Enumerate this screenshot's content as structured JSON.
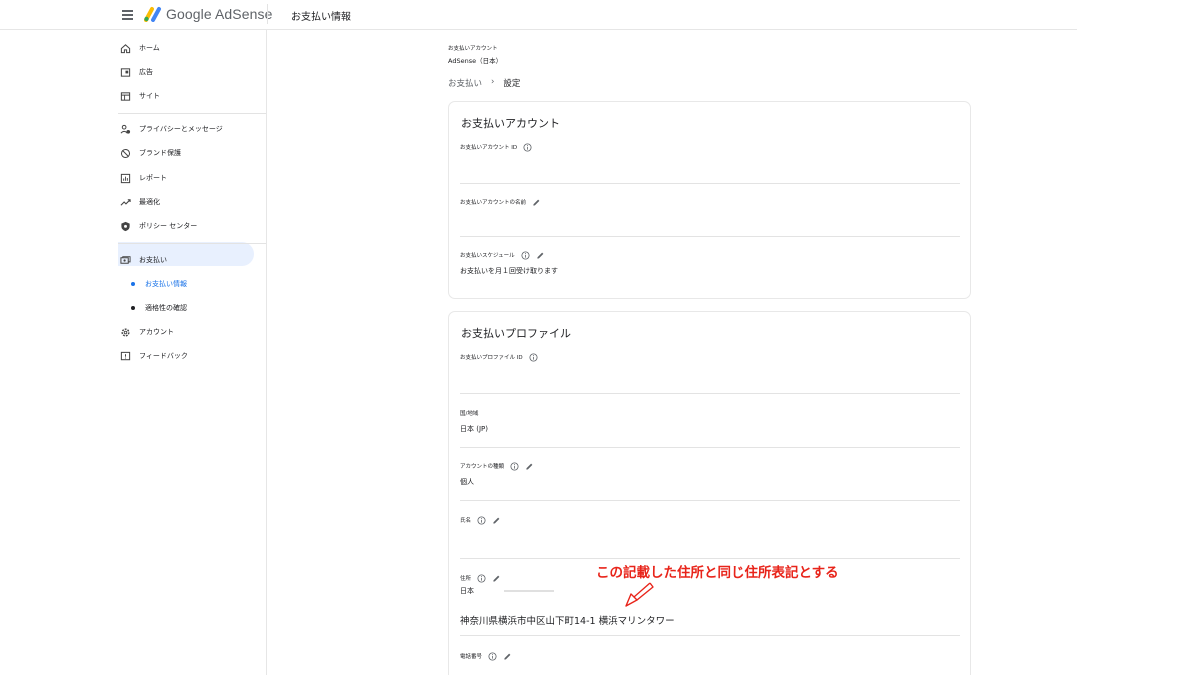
{
  "header": {
    "brand": "Google AdSense",
    "page_title": "お支払い情報"
  },
  "sidebar": {
    "items": [
      {
        "label": "ホーム",
        "icon": "home-icon"
      },
      {
        "label": "広告",
        "icon": "ads-icon"
      },
      {
        "label": "サイト",
        "icon": "sites-icon"
      },
      {
        "label": "プライバシーとメッセージ",
        "icon": "privacy-icon"
      },
      {
        "label": "ブランド保護",
        "icon": "block-icon"
      },
      {
        "label": "レポート",
        "icon": "report-icon"
      },
      {
        "label": "最適化",
        "icon": "trend-icon"
      },
      {
        "label": "ポリシー センター",
        "icon": "shield-icon"
      },
      {
        "label": "お支払い",
        "icon": "payments-icon"
      },
      {
        "label": "お支払い情報",
        "icon": "dot-icon"
      },
      {
        "label": "適格性の確認",
        "icon": "dot-icon"
      },
      {
        "label": "アカウント",
        "icon": "gear-icon"
      },
      {
        "label": "フィードバック",
        "icon": "feedback-icon"
      }
    ]
  },
  "main": {
    "account_label": "お支払いアカウント",
    "account_name": "AdSense（日本）",
    "breadcrumb": {
      "parent": "お支払い",
      "separator": "›",
      "current": "設定"
    },
    "payment_account": {
      "title": "お支払いアカウント",
      "id_label": "お支払いアカウント ID",
      "name_label": "お支払いアカウントの名前",
      "schedule_label": "お支払いスケジュール",
      "schedule_value": "お支払いを月１回受け取ります"
    },
    "payment_profile": {
      "title": "お支払いプロファイル",
      "id_label": "お支払いプロファイル ID",
      "country_label": "国/地域",
      "country_value": "日本 (JP)",
      "account_type_label": "アカウントの種類",
      "account_type_value": "個人",
      "name_label": "氏名",
      "address_label": "住所",
      "address_country": "日本",
      "address_full": "神奈川県横浜市中区山下町14-1 横浜マリンタワー",
      "phone_label": "電話番号"
    }
  },
  "annotation": {
    "text": "この記載した住所と同じ住所表記とする",
    "color": "#e8241a"
  },
  "colors": {
    "accent": "#1a73e8",
    "active_bg": "#e8f0fe"
  }
}
